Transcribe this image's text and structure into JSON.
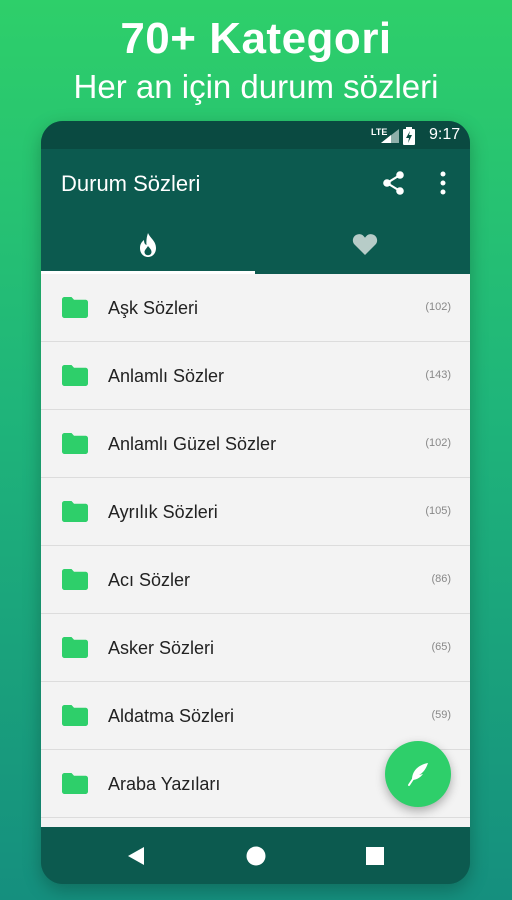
{
  "promo": {
    "title": "70+ Kategori",
    "subtitle": "Her an için durum sözleri"
  },
  "status_bar": {
    "network": "LTE",
    "time": "9:17"
  },
  "app_bar": {
    "title": "Durum Sözleri",
    "actions": [
      "share-icon",
      "more-vert-icon"
    ]
  },
  "tabs": [
    {
      "icon": "flame-icon",
      "selected": true
    },
    {
      "icon": "heart-icon",
      "selected": false
    }
  ],
  "categories": [
    {
      "label": "Aşk Sözleri",
      "count": "(102)"
    },
    {
      "label": "Anlamlı Sözler",
      "count": "(143)"
    },
    {
      "label": "Anlamlı Güzel Sözler",
      "count": "(102)"
    },
    {
      "label": "Ayrılık Sözleri",
      "count": "(105)"
    },
    {
      "label": "Acı Sözler",
      "count": "(86)"
    },
    {
      "label": "Asker Sözleri",
      "count": "(65)"
    },
    {
      "label": "Aldatma Sözleri",
      "count": "(59)"
    },
    {
      "label": "Araba Yazıları",
      "count": ""
    }
  ],
  "fab": {
    "icon": "feather-icon"
  },
  "colors": {
    "primary": "#0c5a4f",
    "accent": "#2ecf6a",
    "list_bg": "#f3f3f3"
  }
}
